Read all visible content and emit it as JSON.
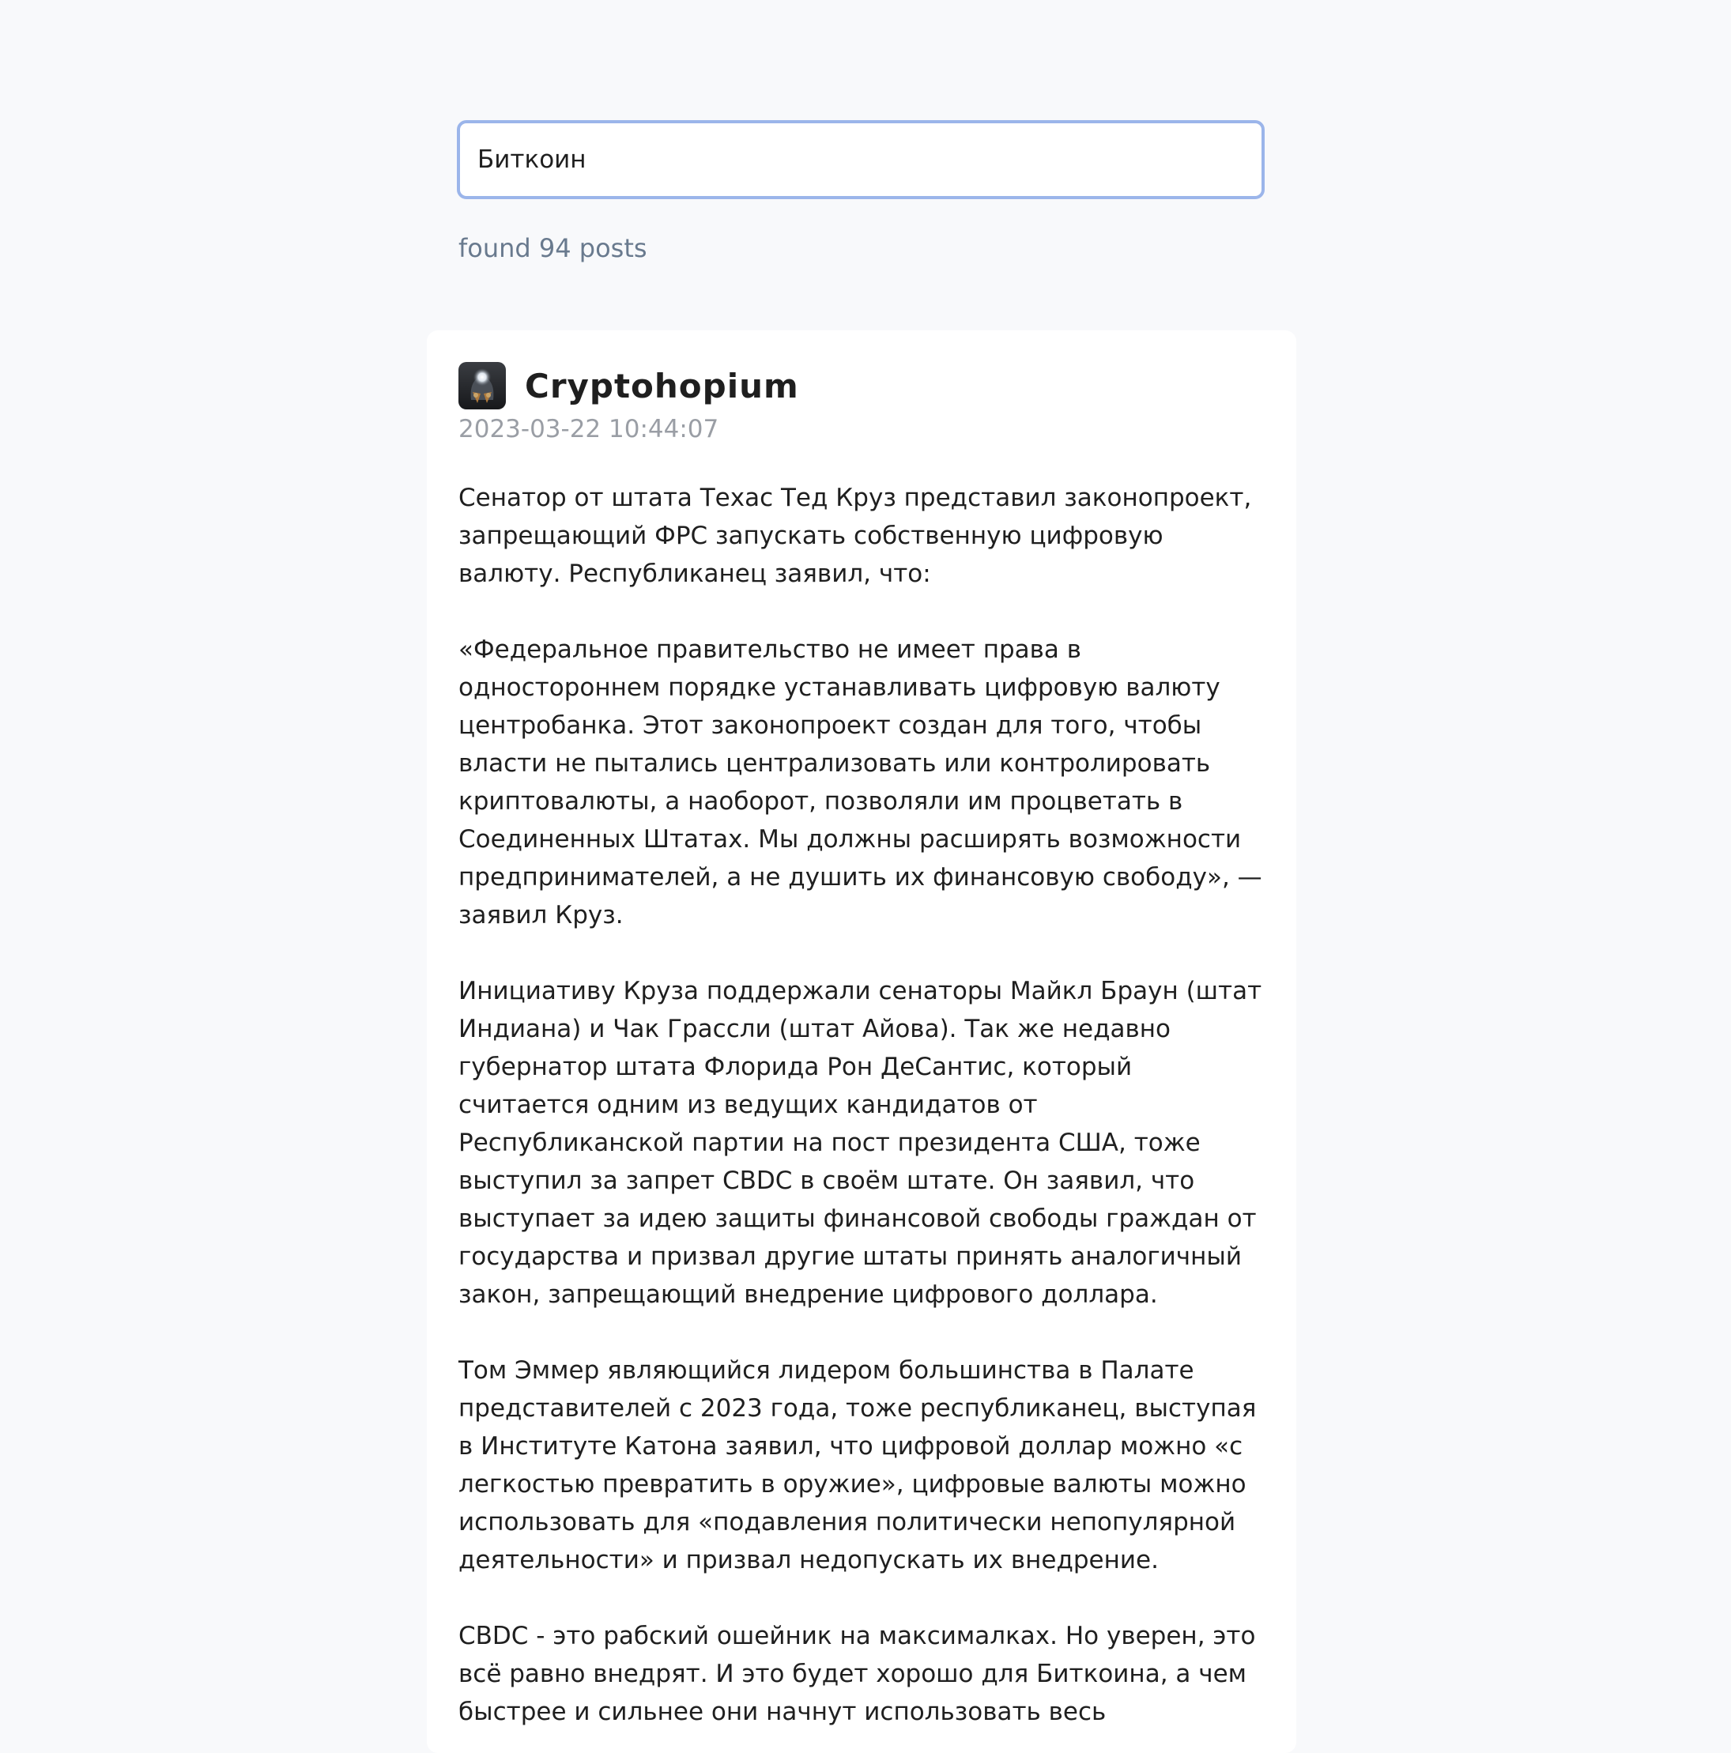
{
  "search": {
    "value": "Биткоин",
    "results_text": "found 94 posts"
  },
  "post": {
    "author": "Cryptohopium",
    "date": "2023-03-22 10:44:07",
    "avatar_icon": "helmet-avatar-icon",
    "body": "Сенатор от штата Техас Тед Круз представил законопроект, запрещающий ФРС запускать собственную цифровую валюту. Республиканец заявил, что:\n\n«Федеральное правительство не имеет права в одностороннем порядке устанавливать цифровую валюту центробанка. Этот законопроект создан для того, чтобы власти не пытались централизовать или контролировать криптовалюты, а наоборот, позволяли им процветать в Соединенных Штатах. Мы должны расширять возможности предпринимателей, а не душить их финансовую свободу», — заявил Круз.\n\nИнициативу Круза поддержали сенаторы Майкл Браун (штат Индиана) и Чак Грассли (штат Айова). Так же недавно губернатор штата Флорида Рон ДеСантис, который считается одним из ведущих кандидатов от Республиканской партии на пост президента США, тоже выступил за запрет CBDC в своём штате. Он заявил, что выступает за идею защиты финансовой свободы граждан от государства и призвал другие штаты принять аналогичный закон, запрещающий внедрение цифрового доллара.\n\nТом Эммер являющийся лидером большинства в Палате представителей с 2023 года, тоже республиканец, выступая в Институте Катона заявил, что цифровой доллар можно «с легкостью превратить в оружие», цифровые валюты можно использовать для «подавления политически непопулярной деятельности» и призвал недопускать их внедрение.\n\nCBDC - это рабский ошейник на максималках. Но уверен, это всё равно внедрят. И это будет хорошо для Биткоина, а чем быстрее и сильнее они начнут использовать весь"
  },
  "colors": {
    "background": "#f8f9fb",
    "input_border": "#9bb5ea",
    "muted_text": "#697a8e",
    "date_text": "#9a9ea5"
  }
}
